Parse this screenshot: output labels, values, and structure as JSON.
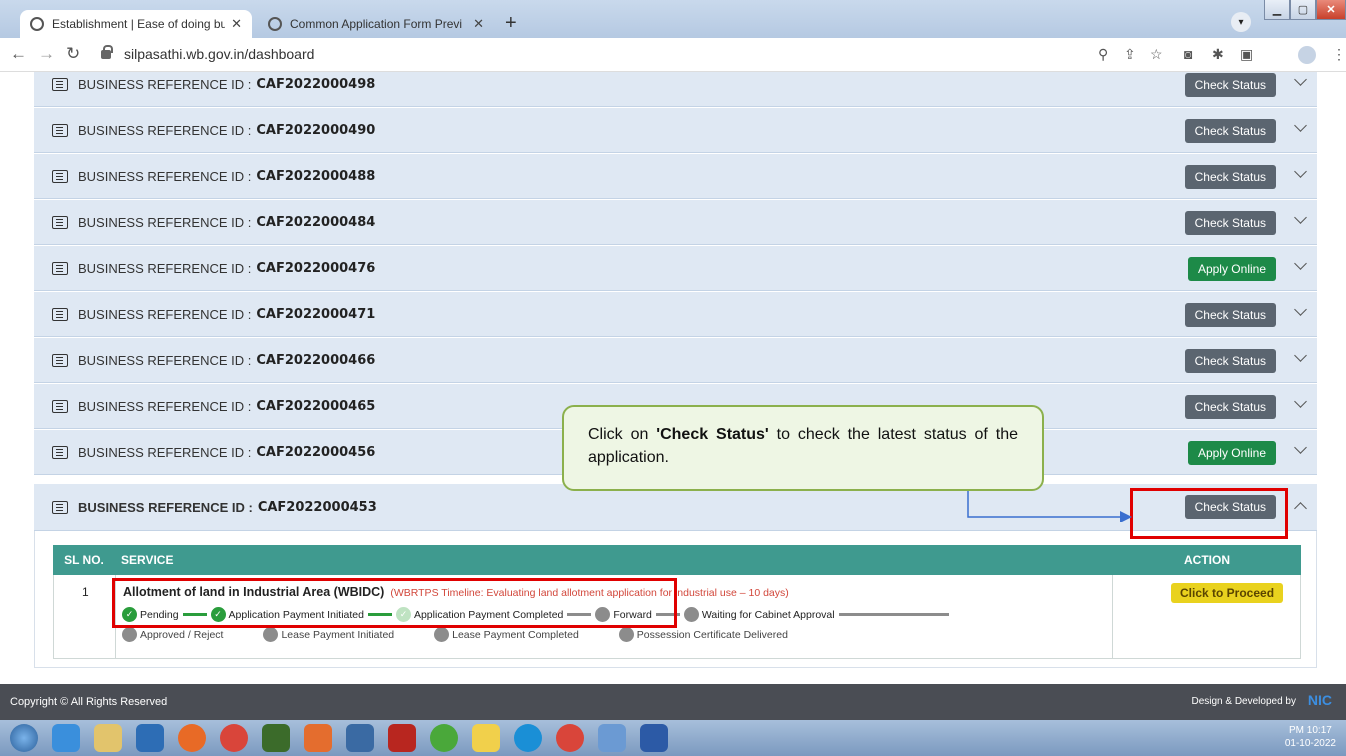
{
  "browser": {
    "tabs": [
      {
        "title": "Establishment | Ease of doing bu",
        "active": true
      },
      {
        "title": "Common Application Form Previ",
        "active": false
      }
    ],
    "url": "silpasathi.wb.gov.in/dashboard"
  },
  "rows": [
    {
      "label": "BUSINESS REFERENCE ID :",
      "id": "CAF2022000498",
      "action": "Check Status"
    },
    {
      "label": "BUSINESS REFERENCE ID :",
      "id": "CAF2022000490",
      "action": "Check Status"
    },
    {
      "label": "BUSINESS REFERENCE ID :",
      "id": "CAF2022000488",
      "action": "Check Status"
    },
    {
      "label": "BUSINESS REFERENCE ID :",
      "id": "CAF2022000484",
      "action": "Check Status"
    },
    {
      "label": "BUSINESS REFERENCE ID :",
      "id": "CAF2022000476",
      "action": "Apply Online"
    },
    {
      "label": "BUSINESS REFERENCE ID :",
      "id": "CAF2022000471",
      "action": "Check Status"
    },
    {
      "label": "BUSINESS REFERENCE ID :",
      "id": "CAF2022000466",
      "action": "Check Status"
    },
    {
      "label": "BUSINESS REFERENCE ID :",
      "id": "CAF2022000465",
      "action": "Check Status"
    },
    {
      "label": "BUSINESS REFERENCE ID :",
      "id": "CAF2022000456",
      "action": "Apply Online"
    },
    {
      "label": "BUSINESS REFERENCE ID :",
      "id": "CAF2022000453",
      "action": "Check Status"
    }
  ],
  "table": {
    "headers": {
      "sl": "SL NO.",
      "service": "SERVICE",
      "action": "ACTION"
    },
    "row": {
      "sl": "1",
      "service": "Allotment of land in Industrial Area (WBIDC)",
      "timeline": "(WBRTPS Timeline: Evaluating land allotment application for industrial use – 10 days)",
      "action": "Click to Proceed"
    },
    "stages_line1": [
      "Pending",
      "Application Payment Initiated",
      "Application Payment Completed",
      "Forward",
      "Waiting for Cabinet Approval"
    ],
    "stages_line2": [
      "Approved / Reject",
      "Lease Payment Initiated",
      "Lease Payment Completed",
      "Possession Certificate Delivered"
    ]
  },
  "callout": {
    "prefix": "Click on ",
    "bold": "'Check Status'",
    "suffix": " to check the latest status of the application."
  },
  "footer": {
    "copyright": "Copyright © All Rights Reserved",
    "designed": "Design & Developed by",
    "brand": "NIC"
  },
  "tray": {
    "time": "PM 10:17",
    "date": "01-10-2022"
  },
  "colors": {
    "row_bg": "#dfe8f3",
    "check_btn": "#5b6570",
    "apply_btn": "#1d8a48",
    "table_head": "#3f9a8f",
    "highlight": "#e00000"
  }
}
